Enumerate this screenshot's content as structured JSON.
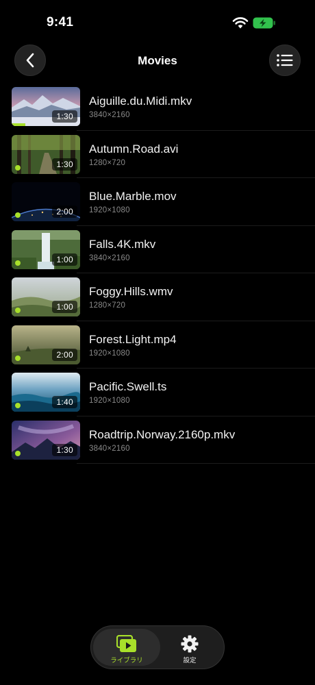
{
  "status_bar": {
    "time": "9:41"
  },
  "header": {
    "title": "Movies"
  },
  "accent_color": "#a8e02a",
  "videos": [
    {
      "title": "Aiguille.du.Midi.mkv",
      "resolution": "3840×2160",
      "duration": "1:30",
      "scene": "mountains",
      "watched_progress": 0.2,
      "unwatched": false
    },
    {
      "title": "Autumn.Road.avi",
      "resolution": "1280×720",
      "duration": "1:30",
      "scene": "forest-road",
      "unwatched": true
    },
    {
      "title": "Blue.Marble.mov",
      "resolution": "1920×1080",
      "duration": "2:00",
      "scene": "earth-night",
      "unwatched": true
    },
    {
      "title": "Falls.4K.mkv",
      "resolution": "3840×2160",
      "duration": "1:00",
      "scene": "waterfall",
      "unwatched": true
    },
    {
      "title": "Foggy.Hills.wmv",
      "resolution": "1280×720",
      "duration": "1:00",
      "scene": "foggy-hills",
      "unwatched": true
    },
    {
      "title": "Forest.Light.mp4",
      "resolution": "1920×1080",
      "duration": "2:00",
      "scene": "forest-light",
      "unwatched": true
    },
    {
      "title": "Pacific.Swell.ts",
      "resolution": "1920×1080",
      "duration": "1:40",
      "scene": "ocean",
      "unwatched": true
    },
    {
      "title": "Roadtrip.Norway.2160p.mkv",
      "resolution": "3840×2160",
      "duration": "1:30",
      "scene": "night-sky-mountains",
      "unwatched": true
    }
  ],
  "tab_bar": {
    "library_label": "ライブラリ",
    "settings_label": "設定",
    "library_icon": "play-library-icon",
    "settings_icon": "gear-icon"
  }
}
